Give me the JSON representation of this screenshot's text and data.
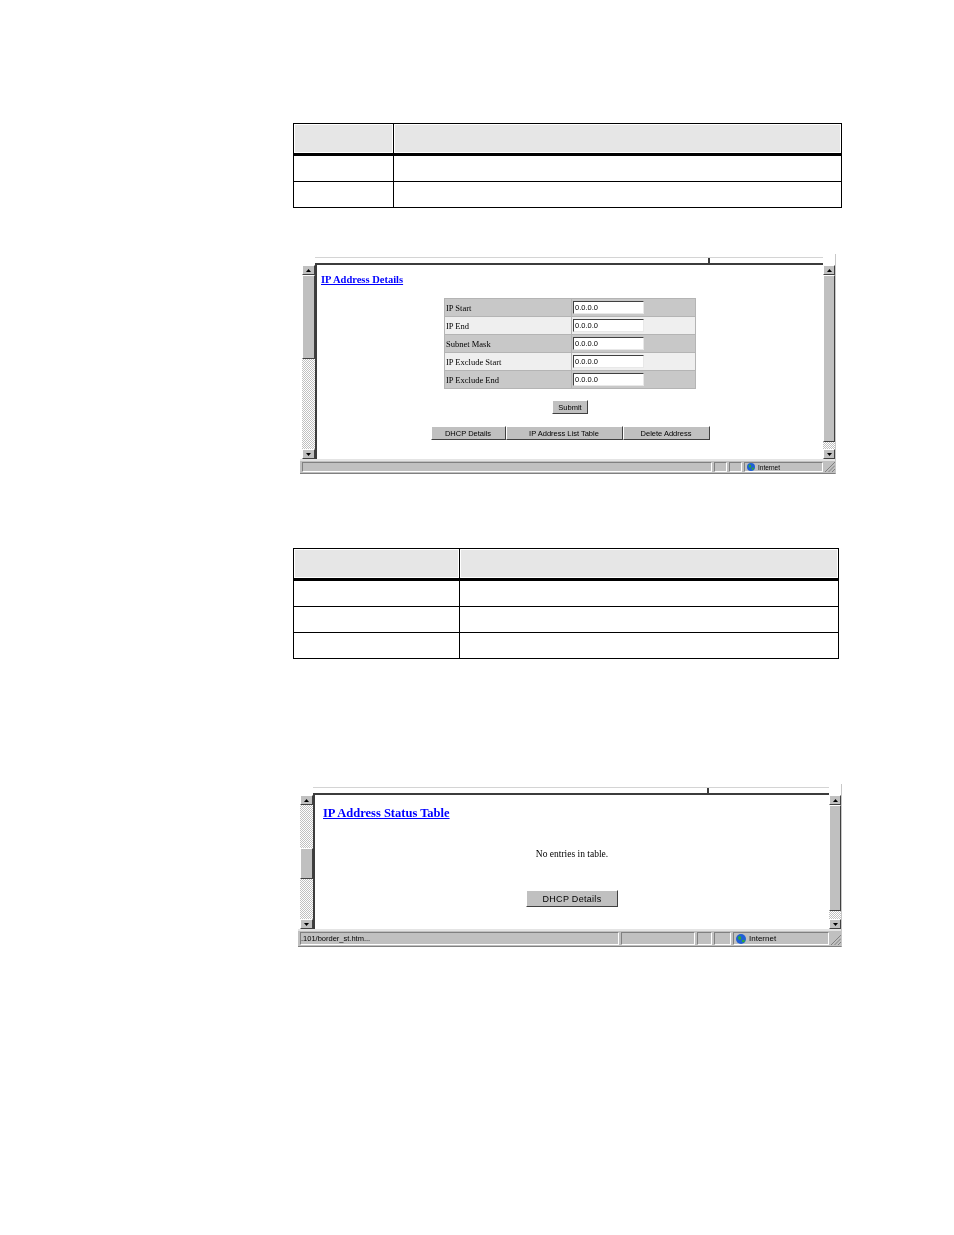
{
  "screens": [
    {
      "kind": "details_form",
      "title": "IP Address Details",
      "fields": [
        {
          "label": "IP Start",
          "value": "0.0.0.0"
        },
        {
          "label": "IP End",
          "value": "0.0.0.0"
        },
        {
          "label": "Subnet Mask",
          "value": "0.0.0.0"
        },
        {
          "label": "IP Exclude Start",
          "value": "0.0.0.0"
        },
        {
          "label": "IP Exclude End",
          "value": "0.0.0.0"
        }
      ],
      "submit_button": "Submit",
      "nav_buttons": [
        "DHCP Details",
        "IP Address List Table",
        "Delete Address"
      ],
      "status_bar": {
        "zone": "Internet"
      }
    },
    {
      "kind": "status_table",
      "title": "IP Address Status Table",
      "message": "No entries in table.",
      "button": "DHCP Details",
      "status_bar": {
        "url": ".101/border_st.htm...",
        "zone": "Internet"
      }
    }
  ]
}
